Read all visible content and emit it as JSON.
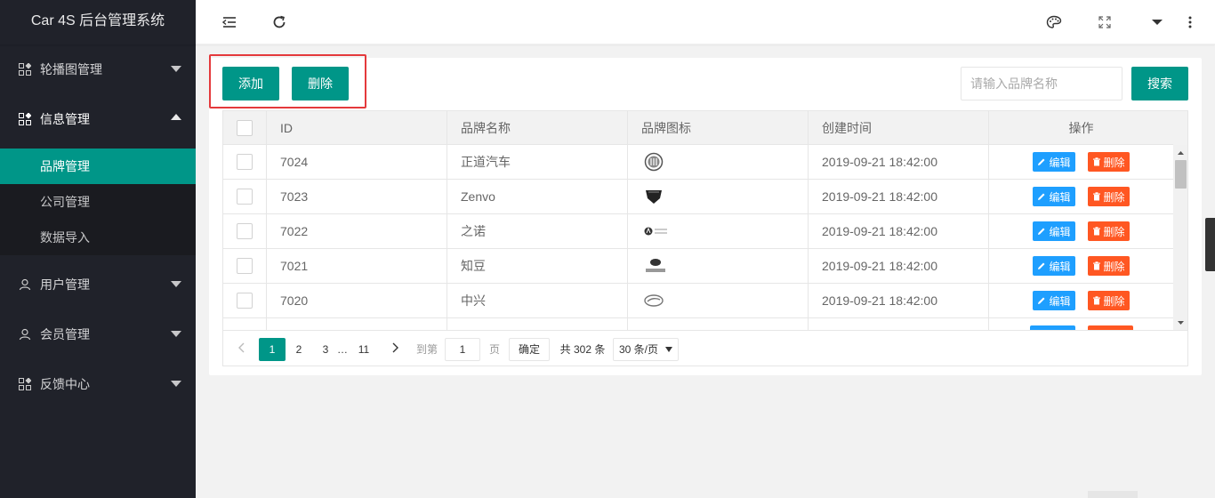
{
  "app": {
    "title": "Car 4S 后台管理系统"
  },
  "sidebar": {
    "items": [
      {
        "label": "轮播图管理",
        "icon": "grid-icon",
        "open": false
      },
      {
        "label": "信息管理",
        "icon": "grid-icon",
        "open": true,
        "children": [
          {
            "label": "品牌管理",
            "active": true
          },
          {
            "label": "公司管理",
            "active": false
          },
          {
            "label": "数据导入",
            "active": false
          }
        ]
      },
      {
        "label": "用户管理",
        "icon": "user-icon",
        "open": false
      },
      {
        "label": "会员管理",
        "icon": "user-icon",
        "open": false
      },
      {
        "label": "反馈中心",
        "icon": "grid-icon",
        "open": false
      }
    ]
  },
  "header": {
    "icons": [
      "menu-collapse-icon",
      "refresh-icon",
      "palette-icon",
      "fullscreen-icon",
      "dropdown-icon",
      "more-icon"
    ]
  },
  "toolbar": {
    "add_label": "添加",
    "delete_label": "删除",
    "search_placeholder": "请输入品牌名称",
    "search_label": "搜索"
  },
  "table": {
    "columns": [
      "ID",
      "品牌名称",
      "品牌图标",
      "创建时间",
      "操作"
    ],
    "rows": [
      {
        "id": "7024",
        "name": "正道汽车",
        "logo": "hybrid-kinetic-logo",
        "created": "2019-09-21 18:42:00"
      },
      {
        "id": "7023",
        "name": "Zenvo",
        "logo": "zenvo-logo",
        "created": "2019-09-21 18:42:00"
      },
      {
        "id": "7022",
        "name": "之诺",
        "logo": "zinoro-logo",
        "created": "2019-09-21 18:42:00"
      },
      {
        "id": "7021",
        "name": "知豆",
        "logo": "zd-logo",
        "created": "2019-09-21 18:42:00"
      },
      {
        "id": "7020",
        "name": "中兴",
        "logo": "zxauto-logo",
        "created": "2019-09-21 18:42:00"
      }
    ],
    "edit_label": "编辑",
    "delete_label": "删除"
  },
  "pagination": {
    "pages": [
      "1",
      "2",
      "3",
      "…",
      "11"
    ],
    "current": "1",
    "goto_prefix": "到第",
    "goto_value": "1",
    "goto_suffix": "页",
    "confirm_label": "确定",
    "total_text": "共 302 条",
    "page_size": "30 条/页"
  },
  "colors": {
    "primary": "#009688",
    "sidebar_bg": "#20222a",
    "edit_btn": "#1e9fff",
    "delete_btn": "#ff5722",
    "highlight_border": "#e4393c"
  }
}
